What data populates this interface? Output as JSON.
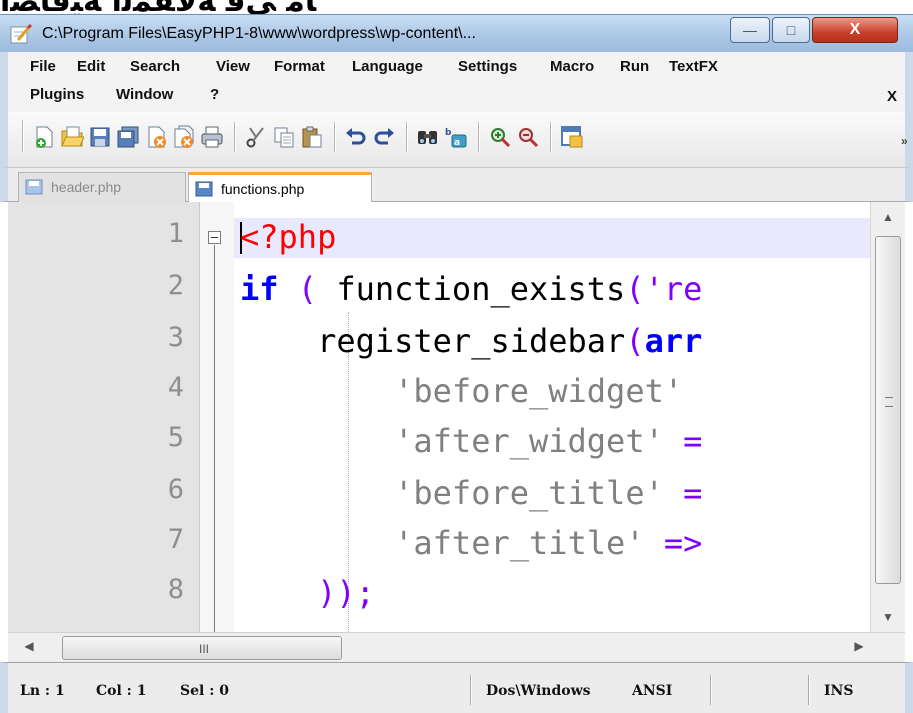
{
  "window": {
    "title": "C:\\Program Files\\EasyPHP1-8\\www\\wordpress\\wp-content\\...",
    "minimize_label": "—",
    "maximize_label": "□",
    "close_label": "X"
  },
  "menu": {
    "row1": [
      "File",
      "Edit",
      "Search",
      "View",
      "Format",
      "Language",
      "Settings",
      "Macro",
      "Run",
      "TextFX"
    ],
    "row2": [
      "Plugins",
      "Window",
      "?"
    ],
    "close_doc": "X"
  },
  "toolbar": {
    "icons": [
      "new-file-icon",
      "open-file-icon",
      "save-icon",
      "save-all-icon",
      "close-icon",
      "close-all-icon",
      "print-icon",
      "cut-icon",
      "copy-icon",
      "paste-icon",
      "undo-icon",
      "redo-icon",
      "find-icon",
      "replace-icon",
      "zoom-in-icon",
      "zoom-out-icon",
      "sync-scroll-icon"
    ],
    "overflow": "»"
  },
  "tabs": [
    {
      "label": "header.php",
      "active": false
    },
    {
      "label": "functions.php",
      "active": true
    }
  ],
  "editor": {
    "line_numbers": [
      "1",
      "2",
      "3",
      "4",
      "5",
      "6",
      "7",
      "8"
    ],
    "lines": [
      [
        {
          "t": "<?php",
          "c": "php"
        }
      ],
      [
        {
          "t": "if",
          "c": "kw"
        },
        {
          "t": " ( ",
          "c": "op"
        },
        {
          "t": "function_exists",
          "c": "fn"
        },
        {
          "t": "('re",
          "c": "op"
        }
      ],
      [
        {
          "t": "    register_sidebar",
          "c": "fn"
        },
        {
          "t": "(",
          "c": "op"
        },
        {
          "t": "arr",
          "c": "arr"
        }
      ],
      [
        {
          "t": "        'before_widget'",
          "c": "str"
        },
        {
          "t": " ",
          "c": "op"
        }
      ],
      [
        {
          "t": "        'after_widget'",
          "c": "str"
        },
        {
          "t": " =",
          "c": "op"
        }
      ],
      [
        {
          "t": "        'before_title'",
          "c": "str"
        },
        {
          "t": " =",
          "c": "op"
        }
      ],
      [
        {
          "t": "        'after_title'",
          "c": "str"
        },
        {
          "t": " =>",
          "c": "op"
        }
      ],
      [
        {
          "t": "    ));",
          "c": "op"
        }
      ]
    ],
    "colors": {
      "php": "#ff0000",
      "kw": "#0000ff",
      "op": "#8000ff",
      "str": "#808080",
      "current_line": "#e8e8ff"
    }
  },
  "hscroll": {
    "grip": "III"
  },
  "status": {
    "ln": "Ln : 1",
    "col": "Col : 1",
    "sel": "Sel : 0",
    "eol": "Dos\\Windows",
    "encoding": "ANSI",
    "mode": "INS"
  }
}
